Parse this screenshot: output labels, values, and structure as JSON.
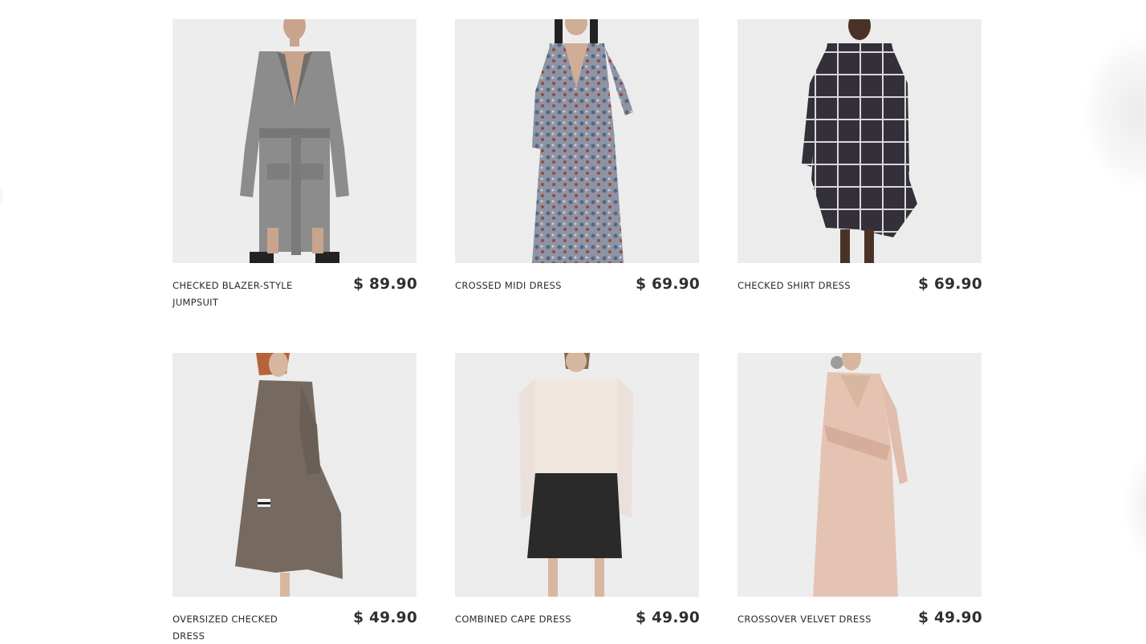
{
  "products": [
    {
      "name": "CHECKED BLAZER-STYLE JUMPSUIT",
      "price": "$ 89.90",
      "image": "woman-in-grey-checked-belted-blazer-jumpsuit"
    },
    {
      "name": "CROSSED MIDI DRESS",
      "price": "$ 69.90",
      "image": "woman-in-patterned-wrap-midi-dress"
    },
    {
      "name": "CHECKED SHIRT DRESS",
      "price": "$ 69.90",
      "image": "woman-in-dark-checked-shirt-dress"
    },
    {
      "name": "OVERSIZED CHECKED DRESS",
      "price": "$ 49.90",
      "image": "woman-in-brown-checked-ruffle-dress"
    },
    {
      "name": "COMBINED CAPE DRESS",
      "price": "$ 49.90",
      "image": "woman-in-cream-and-black-cape-dress"
    },
    {
      "name": "CROSSOVER VELVET DRESS",
      "price": "$ 49.90",
      "image": "woman-in-pink-velvet-crossover-dress"
    }
  ],
  "colors": {
    "image_background": "#ececec",
    "text": "#2a2a2a",
    "price": "#2f2f2f"
  }
}
